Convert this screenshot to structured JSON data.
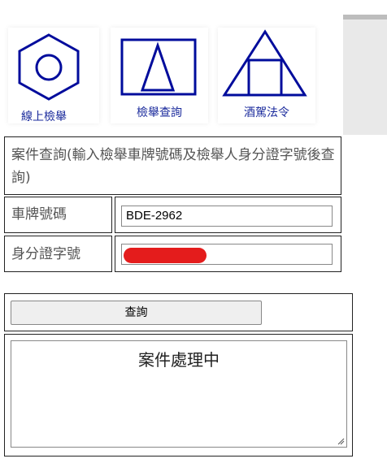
{
  "nav": {
    "tiles": [
      {
        "label": "線上檢舉",
        "icon": "hexagon-nut-icon"
      },
      {
        "label": "檢舉查詢",
        "icon": "triangle-in-rectangle-icon"
      },
      {
        "label": "酒駕法令",
        "icon": "square-in-triangle-icon"
      }
    ]
  },
  "form": {
    "title": "案件查詢(輸入檢舉車牌號碼及檢舉人身分證字號後查詢)",
    "plate": {
      "label": "車牌號碼",
      "value": "BDE-2962"
    },
    "id": {
      "label": "身分證字號",
      "value": ""
    },
    "query_button": "查詢",
    "result_text": "案件處理中"
  },
  "colors": {
    "icon_blue": "#000c9c",
    "redaction": "#e41c1c"
  }
}
